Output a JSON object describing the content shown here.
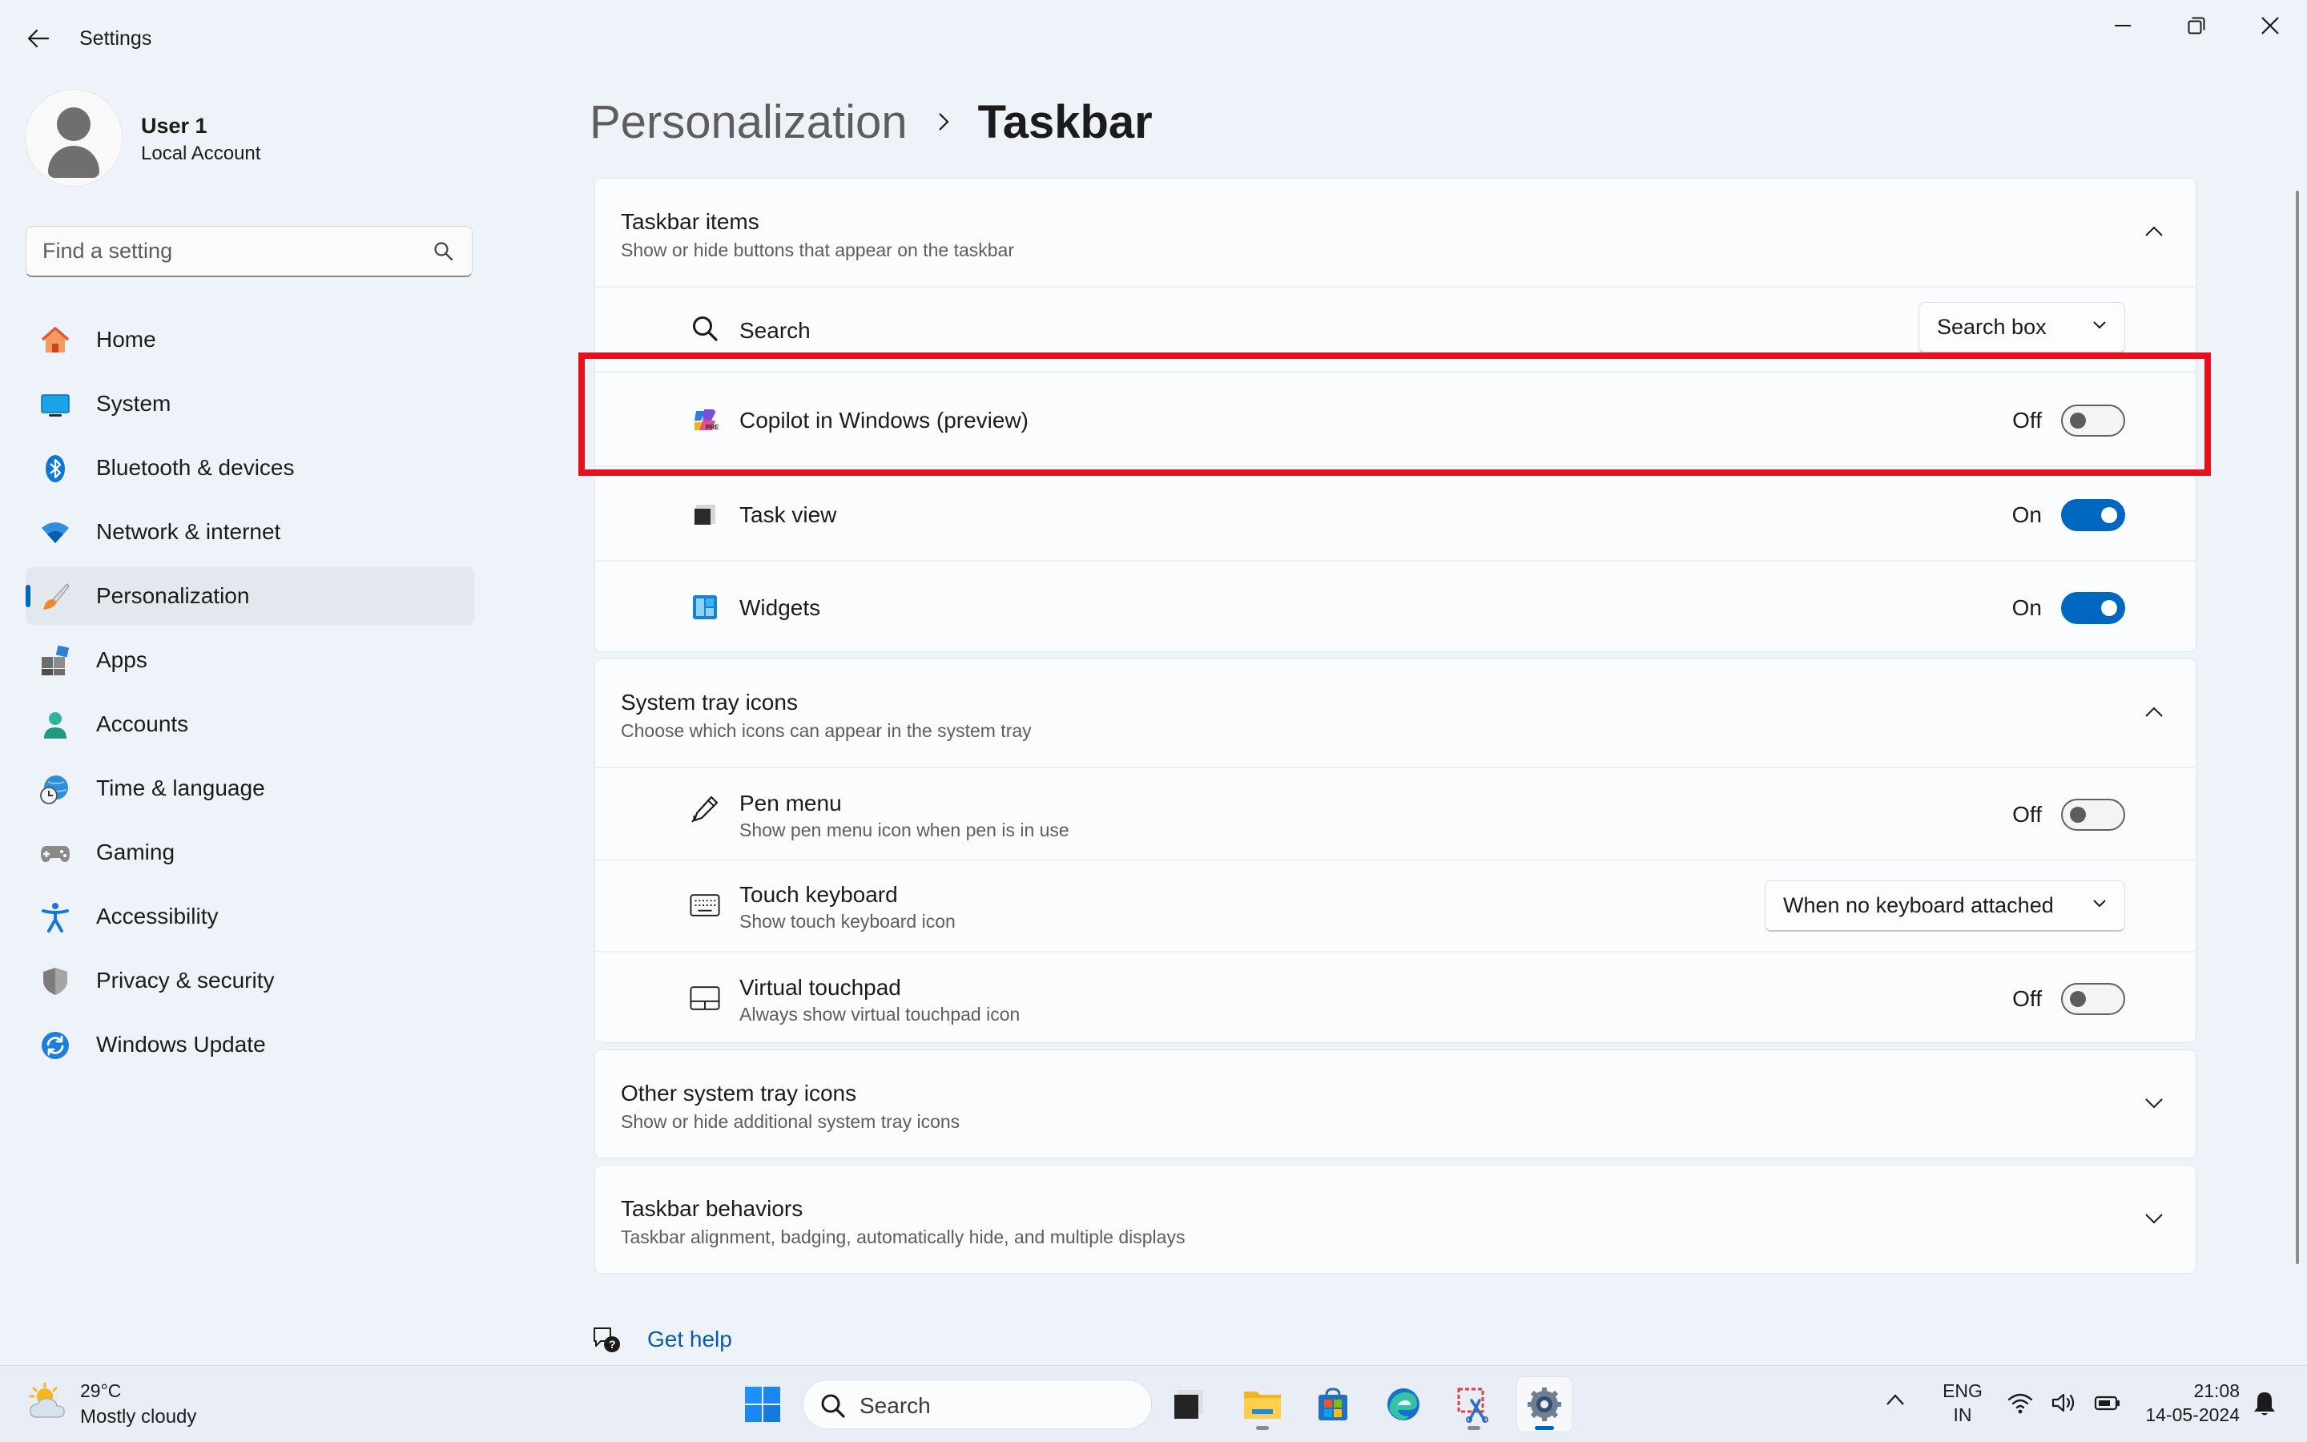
{
  "window": {
    "title": "Settings",
    "back_icon": "back-arrow-icon",
    "controls": [
      "minimize-icon",
      "restore-icon",
      "close-icon"
    ]
  },
  "profile": {
    "name": "User 1",
    "account_type": "Local Account"
  },
  "search": {
    "placeholder": "Find a setting",
    "icon": "search-icon"
  },
  "sidebar": {
    "items": [
      {
        "label": "Home",
        "icon": "home-icon"
      },
      {
        "label": "System",
        "icon": "system-icon"
      },
      {
        "label": "Bluetooth & devices",
        "icon": "bluetooth-icon"
      },
      {
        "label": "Network & internet",
        "icon": "wifi-icon"
      },
      {
        "label": "Personalization",
        "icon": "brush-icon",
        "active": true
      },
      {
        "label": "Apps",
        "icon": "apps-icon"
      },
      {
        "label": "Accounts",
        "icon": "accounts-icon"
      },
      {
        "label": "Time & language",
        "icon": "clock-globe-icon"
      },
      {
        "label": "Gaming",
        "icon": "gamepad-icon"
      },
      {
        "label": "Accessibility",
        "icon": "accessibility-icon"
      },
      {
        "label": "Privacy & security",
        "icon": "shield-icon"
      },
      {
        "label": "Windows Update",
        "icon": "update-icon"
      }
    ]
  },
  "breadcrumb": {
    "parent": "Personalization",
    "current": "Taskbar"
  },
  "taskbar_items": {
    "title": "Taskbar items",
    "description": "Show or hide buttons that appear on the taskbar",
    "rows": {
      "search": {
        "label": "Search",
        "value": "Search box"
      },
      "copilot": {
        "label": "Copilot in Windows (preview)",
        "state": "Off"
      },
      "task_view": {
        "label": "Task view",
        "state": "On"
      },
      "widgets": {
        "label": "Widgets",
        "state": "On"
      }
    }
  },
  "system_tray": {
    "title": "System tray icons",
    "description": "Choose which icons can appear in the system tray",
    "rows": {
      "pen_menu": {
        "label": "Pen menu",
        "sub": "Show pen menu icon when pen is in use",
        "state": "Off"
      },
      "touch_keyboard": {
        "label": "Touch keyboard",
        "sub": "Show touch keyboard icon",
        "value": "When no keyboard attached"
      },
      "virtual_touchpad": {
        "label": "Virtual touchpad",
        "sub": "Always show virtual touchpad icon",
        "state": "Off"
      }
    }
  },
  "other_tray": {
    "title": "Other system tray icons",
    "description": "Show or hide additional system tray icons"
  },
  "behaviors": {
    "title": "Taskbar behaviors",
    "description": "Taskbar alignment, badging, automatically hide, and multiple displays"
  },
  "help": {
    "label": "Get help"
  },
  "os_taskbar": {
    "weather": {
      "temp": "29°C",
      "desc": "Mostly cloudy"
    },
    "search_label": "Search",
    "apps": [
      "start-icon",
      "task-view-icon",
      "file-explorer-icon",
      "store-icon",
      "edge-icon",
      "snipping-tool-icon",
      "settings-icon"
    ],
    "lang_line1": "ENG",
    "lang_line2": "IN",
    "time": "21:08",
    "date": "14-05-2024"
  },
  "colors": {
    "accent": "#0067c0",
    "highlight_box": "#e8101c",
    "background": "#eef2f9"
  }
}
